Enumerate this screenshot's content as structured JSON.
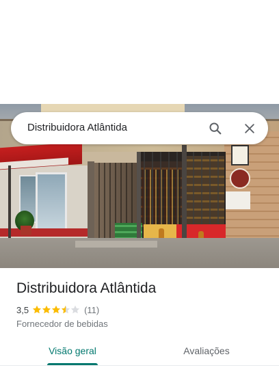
{
  "search": {
    "query": "Distribuidora Atlântida",
    "search_icon": "search-icon",
    "close_icon": "close-icon"
  },
  "place": {
    "name": "Distribuidora Atlântida",
    "rating_text": "3,5",
    "rating_value": 3.5,
    "rating_max": 5,
    "review_count": "(11)",
    "category": "Fornecedor de bebidas"
  },
  "tabs": [
    {
      "label": "Visão geral",
      "active": true
    },
    {
      "label": "Avaliações",
      "active": false
    }
  ],
  "colors": {
    "accent": "#01786e",
    "star_filled": "#fbbc04",
    "star_empty": "#dadce0"
  }
}
